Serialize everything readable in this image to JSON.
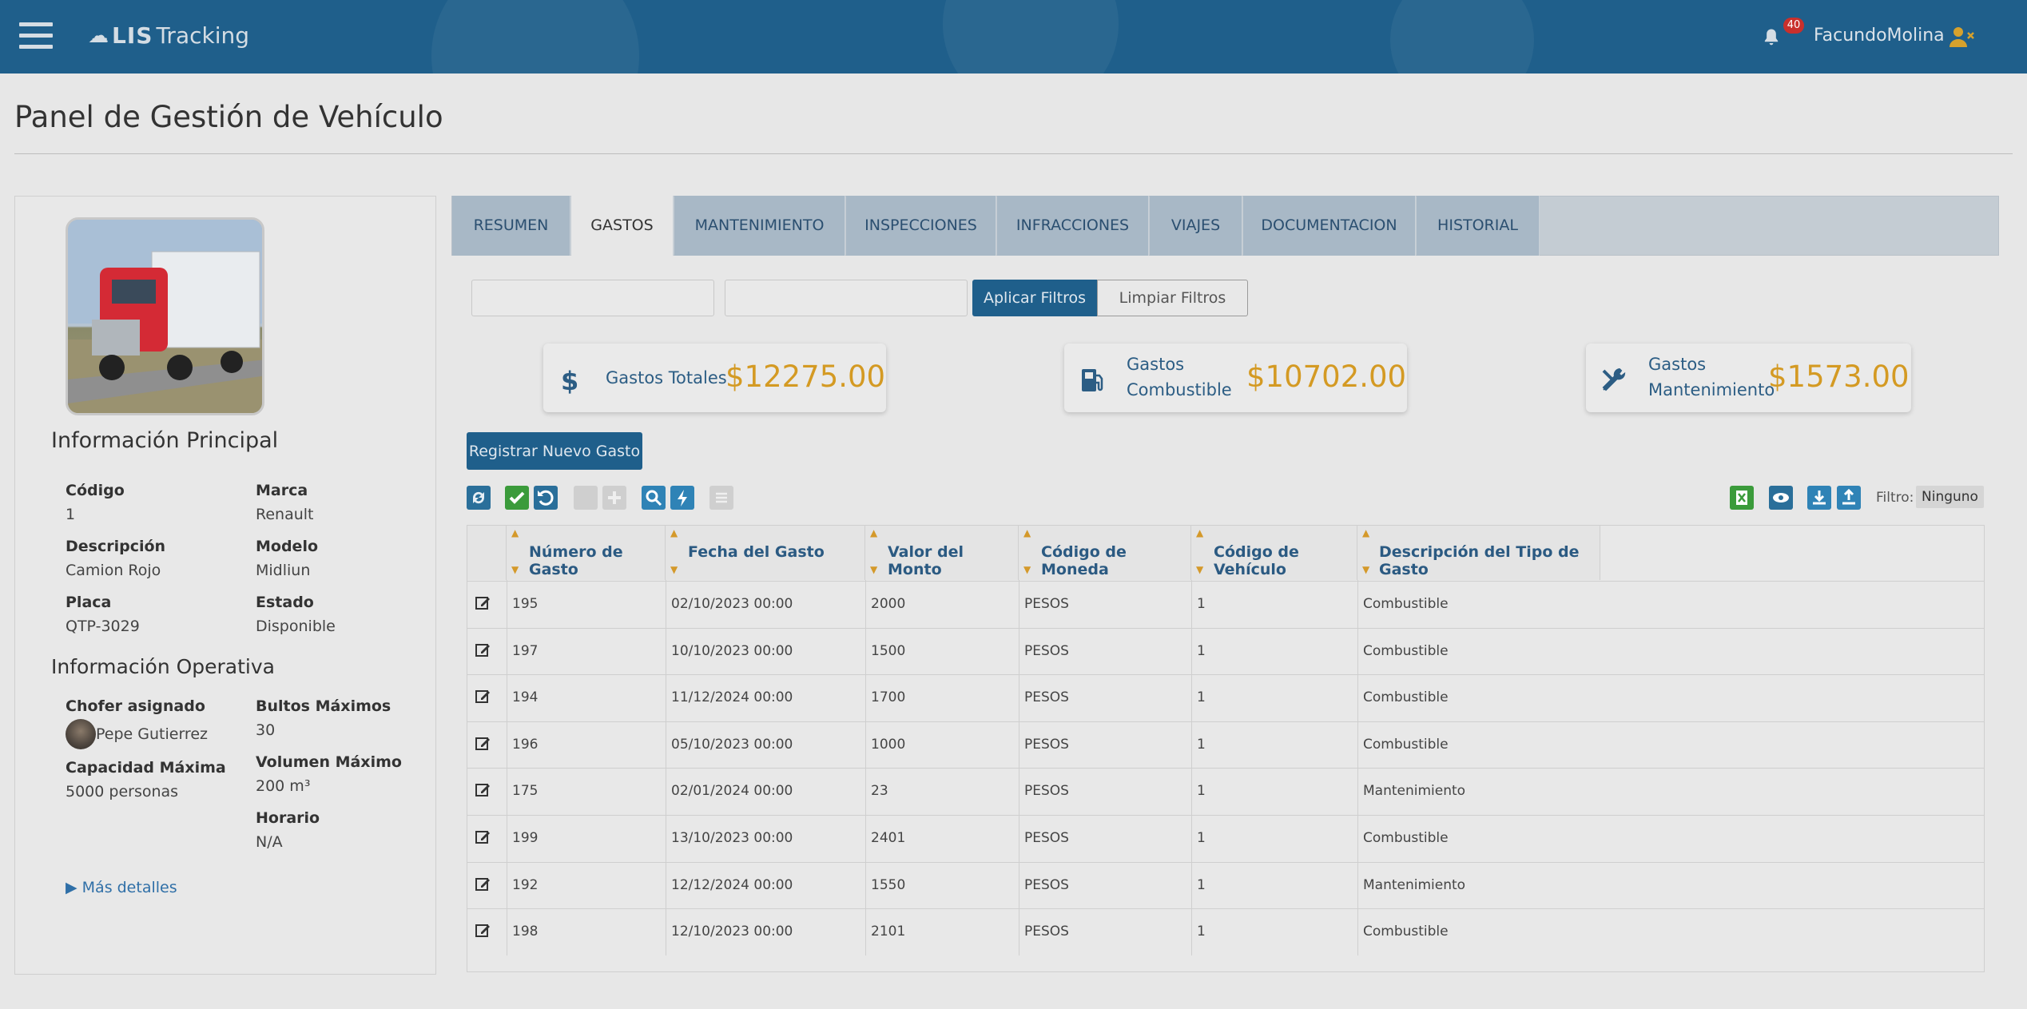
{
  "header": {
    "brand_bold": "LIS",
    "brand_light": "Tracking",
    "notifications": "40",
    "username": "FacundoMolina"
  },
  "page_title": "Panel de Gestión de Vehículo",
  "vehicle": {
    "main_title": "Información Principal",
    "fields": {
      "codigo_label": "Código",
      "codigo": "1",
      "marca_label": "Marca",
      "marca": "Renault",
      "descripcion_label": "Descripción",
      "descripcion": "Camion Rojo",
      "modelo_label": "Modelo",
      "modelo": "Midliun",
      "placa_label": "Placa",
      "placa": "QTP-3029",
      "estado_label": "Estado",
      "estado": "Disponible"
    },
    "ops_title": "Información Operativa",
    "ops": {
      "chofer_label": "Chofer asignado",
      "chofer": "Pepe Gutierrez",
      "bultos_label": "Bultos Máximos",
      "bultos": "30",
      "capacidad_label": "Capacidad Máxima",
      "capacidad": "5000 personas",
      "volumen_label": "Volumen Máximo",
      "volumen": "200 m³",
      "horario_label": "Horario",
      "horario": "N/A"
    },
    "more_details": "▶ Más detalles"
  },
  "tabs": [
    {
      "label": "RESUMEN"
    },
    {
      "label": "GASTOS"
    },
    {
      "label": "MANTENIMIENTO"
    },
    {
      "label": "INSPECCIONES"
    },
    {
      "label": "INFRACCIONES"
    },
    {
      "label": "VIAJES"
    },
    {
      "label": "DOCUMENTACION"
    },
    {
      "label": "HISTORIAL"
    }
  ],
  "filters": {
    "apply": "Aplicar Filtros",
    "clear": "Limpiar Filtros"
  },
  "stats": {
    "total_label": "Gastos Totales",
    "total_value": "$12275.00",
    "fuel_label_1": "Gastos",
    "fuel_label_2": "Combustible",
    "fuel_value": "$10702.00",
    "maint_label_1": "Gastos",
    "maint_label_2": "Mantenimiento",
    "maint_value": "$1573.00"
  },
  "new_expense_button": "Registrar Nuevo Gasto",
  "toolbar": {
    "filter_label": "Filtro:",
    "filter_value": "Ninguno"
  },
  "table": {
    "columns": [
      "Número de Gasto",
      "Fecha del Gasto",
      "Valor del Monto",
      "Código de Moneda",
      "Código de Vehículo",
      "Descripción del Tipo de Gasto"
    ],
    "rows": [
      [
        "195",
        "02/10/2023 00:00",
        "2000",
        "PESOS",
        "1",
        "Combustible"
      ],
      [
        "197",
        "10/10/2023 00:00",
        "1500",
        "PESOS",
        "1",
        "Combustible"
      ],
      [
        "194",
        "11/12/2024 00:00",
        "1700",
        "PESOS",
        "1",
        "Combustible"
      ],
      [
        "196",
        "05/10/2023 00:00",
        "1000",
        "PESOS",
        "1",
        "Combustible"
      ],
      [
        "175",
        "02/01/2024 00:00",
        "23",
        "PESOS",
        "1",
        "Mantenimiento"
      ],
      [
        "199",
        "13/10/2023 00:00",
        "2401",
        "PESOS",
        "1",
        "Combustible"
      ],
      [
        "192",
        "12/12/2024 00:00",
        "1550",
        "PESOS",
        "1",
        "Mantenimiento"
      ],
      [
        "198",
        "12/10/2023 00:00",
        "2101",
        "PESOS",
        "1",
        "Combustible"
      ]
    ]
  },
  "colors": {
    "header_bg": "#1f5f8b",
    "accent_gold": "#d49a23",
    "link_blue": "#2f6fa7"
  }
}
